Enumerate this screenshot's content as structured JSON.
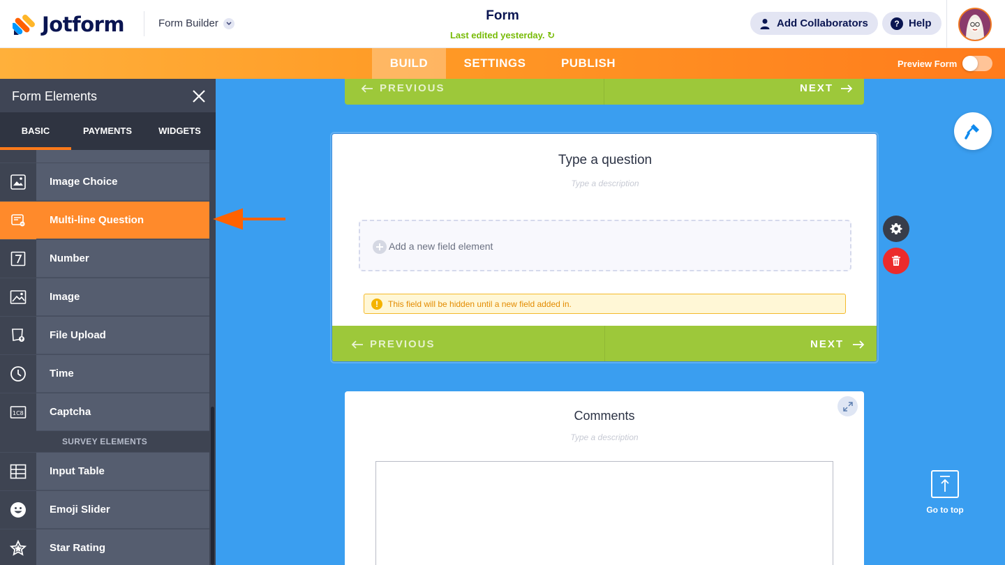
{
  "header": {
    "brand": "Jotform",
    "mode_label": "Form Builder",
    "form_title": "Form",
    "last_edited": "Last edited yesterday.",
    "collaborators_label": "Add Collaborators",
    "help_label": "Help"
  },
  "nav": {
    "tabs": [
      "BUILD",
      "SETTINGS",
      "PUBLISH"
    ],
    "active_tab": "BUILD",
    "preview_label": "Preview Form",
    "preview_enabled": false
  },
  "sidebar": {
    "title": "Form Elements",
    "tabs": [
      "BASIC",
      "PAYMENTS",
      "WIDGETS"
    ],
    "active_tab": "BASIC",
    "items": [
      {
        "label": "Image Choice",
        "icon": "image-choice-icon"
      },
      {
        "label": "Multi-line Question",
        "icon": "multiline-question-icon",
        "active": true
      },
      {
        "label": "Number",
        "icon": "number-icon"
      },
      {
        "label": "Image",
        "icon": "image-icon"
      },
      {
        "label": "File Upload",
        "icon": "file-upload-icon"
      },
      {
        "label": "Time",
        "icon": "clock-icon"
      },
      {
        "label": "Captcha",
        "icon": "captcha-icon"
      }
    ],
    "section_label": "SURVEY ELEMENTS",
    "survey_items": [
      {
        "label": "Input Table",
        "icon": "table-icon"
      },
      {
        "label": "Emoji Slider",
        "icon": "emoji-icon"
      },
      {
        "label": "Star Rating",
        "icon": "star-icon"
      }
    ]
  },
  "canvas": {
    "prev_label": "PREVIOUS",
    "next_label": "NEXT",
    "question": {
      "title": "Type a question",
      "description_placeholder": "Type a description",
      "add_field_label": "Add a new field element",
      "warning": "This field will be hidden until a new field added in.",
      "warning_icon": "!"
    },
    "comments": {
      "title": "Comments",
      "description_placeholder": "Type a description"
    },
    "go_to_top": "Go to top"
  },
  "colors": {
    "orange_accent": "#ff7a1a",
    "green_nav": "#9dc83a",
    "canvas_blue": "#3a9ef0",
    "brand_navy": "#0a1551",
    "delete_red": "#ec2b2b"
  }
}
